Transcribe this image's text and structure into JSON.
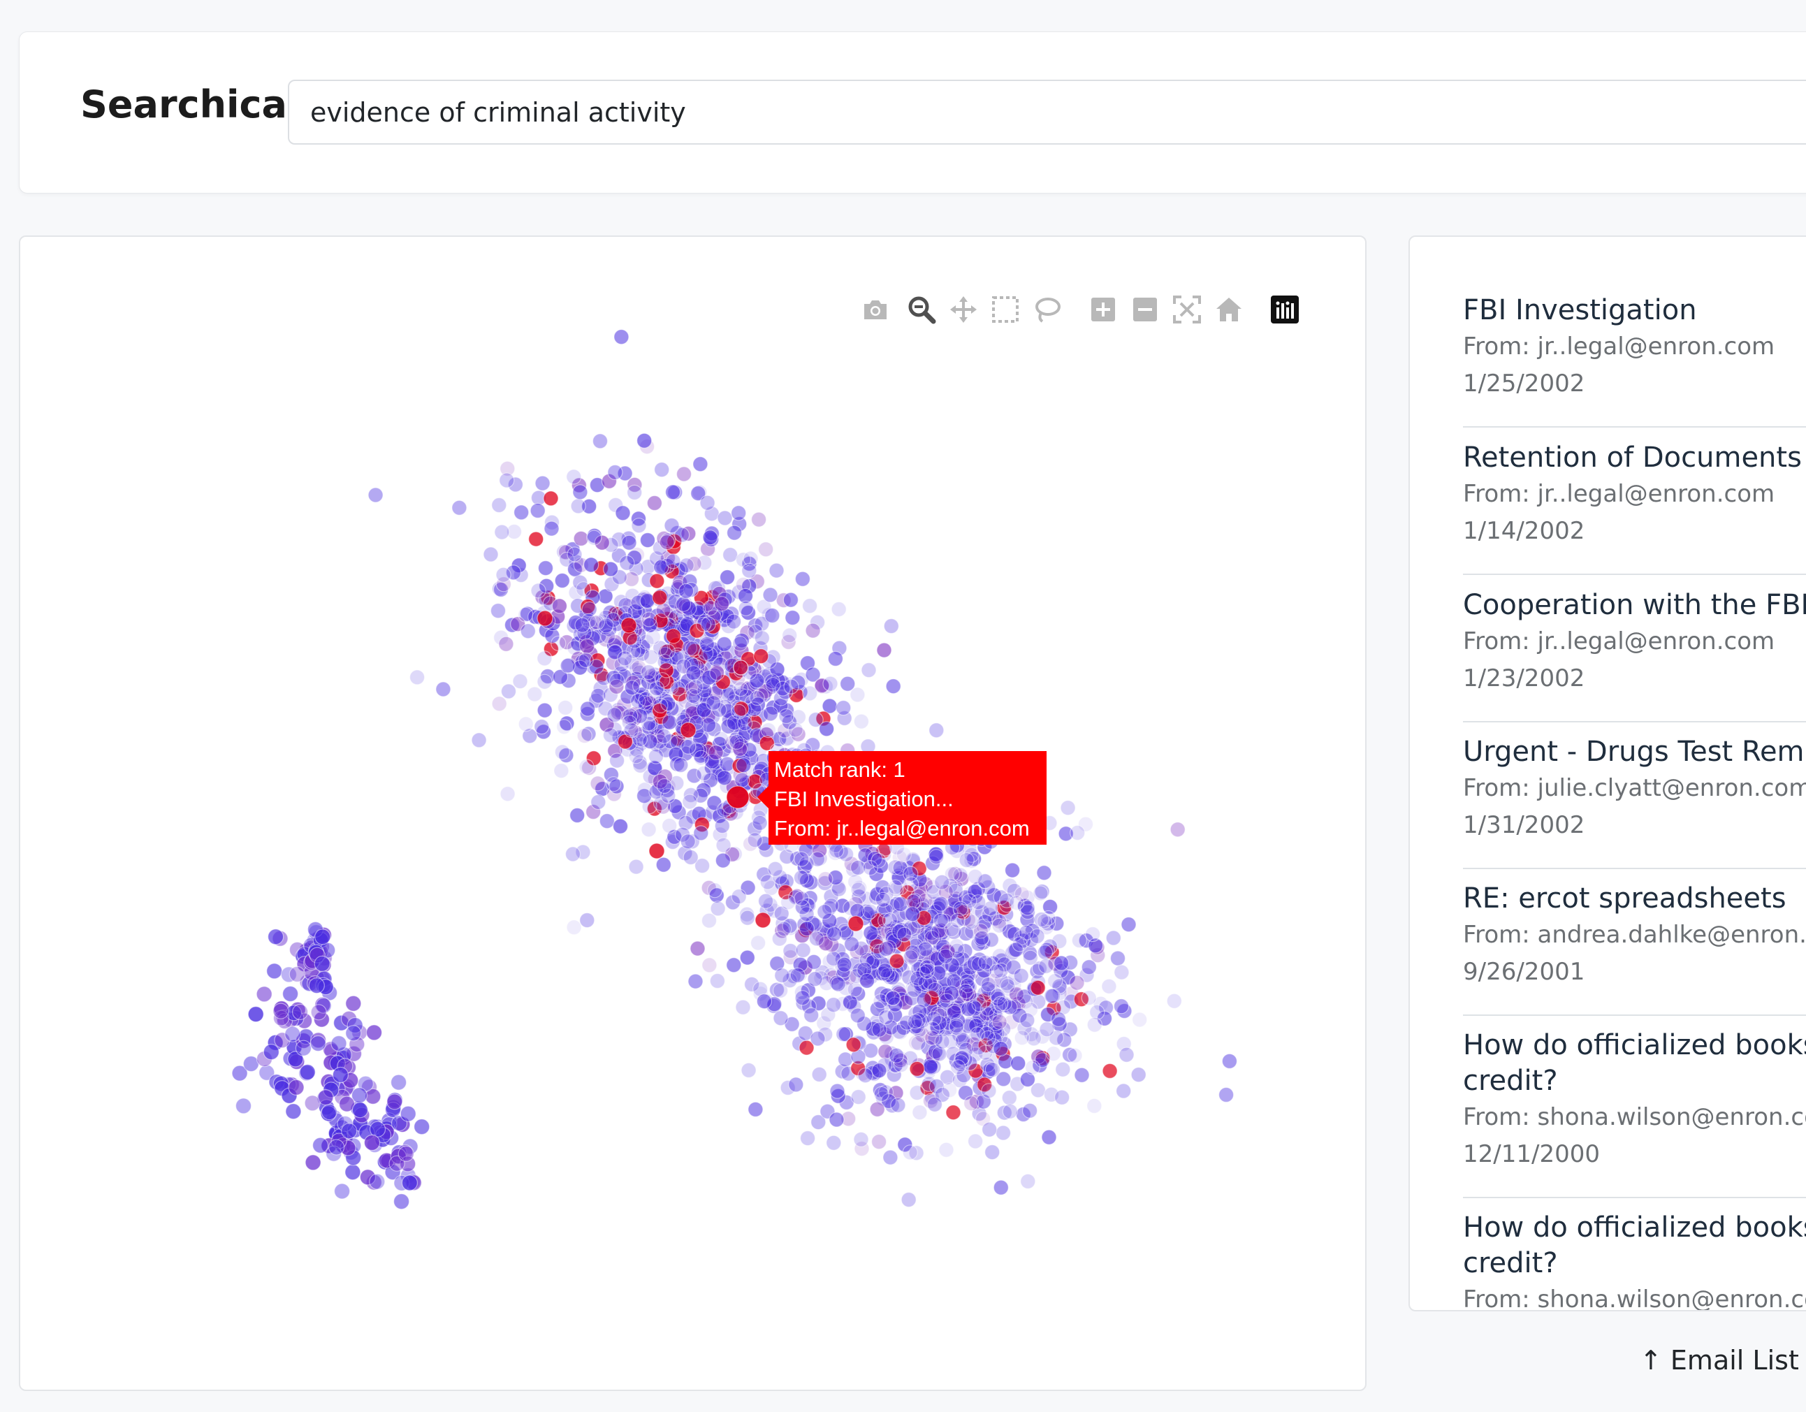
{
  "header": {
    "brand": "Searchica",
    "search_value": "evidence of criminal activity"
  },
  "plot": {
    "modebar": [
      {
        "name": "camera-icon",
        "label": "Download plot as a png"
      },
      {
        "name": "zoom-icon",
        "label": "Zoom"
      },
      {
        "name": "pan-icon",
        "label": "Pan"
      },
      {
        "name": "box-select-icon",
        "label": "Box Select"
      },
      {
        "name": "lasso-select-icon",
        "label": "Lasso Select"
      },
      {
        "name": "zoom-in-icon",
        "label": "Zoom in"
      },
      {
        "name": "zoom-out-icon",
        "label": "Zoom out"
      },
      {
        "name": "autoscale-icon",
        "label": "Autoscale"
      },
      {
        "name": "reset-axes-icon",
        "label": "Reset axes"
      },
      {
        "name": "plotly-logo-icon",
        "label": "Produced with Plotly"
      }
    ],
    "tooltip": {
      "line1": "Match rank: 1",
      "line2": "FBI Investigation...",
      "line3": "From: jr..legal@enron.com"
    },
    "colors": {
      "low_match": "#4a2ee0",
      "high_match": "#e0001a",
      "tooltip_bg": "#ff0000"
    }
  },
  "emails": [
    {
      "subject": "FBI Investigation",
      "from": "From: jr..legal@enron.com",
      "date": "1/25/2002"
    },
    {
      "subject": "Retention of Documents",
      "from": "From: jr..legal@enron.com",
      "date": "1/14/2002"
    },
    {
      "subject": "Cooperation with the FBI",
      "from": "From: jr..legal@enron.com",
      "date": "1/23/2002"
    },
    {
      "subject": "Urgent - Drugs Test Remir",
      "from": "From: julie.clyatt@enron.com",
      "date": "1/31/2002"
    },
    {
      "subject": "RE: ercot spreadsheets",
      "from": "From: andrea.dahlke@enron.co",
      "date": "9/26/2001"
    },
    {
      "subject": "How do officialized books\ncredit?",
      "from": "From: shona.wilson@enron.con",
      "date": "12/11/2000"
    },
    {
      "subject": "How do officialized books\ncredit?",
      "from": "From: shona.wilson@enron.con",
      "date": ""
    }
  ],
  "footer": {
    "list_toggle": "↑ Email List To"
  }
}
